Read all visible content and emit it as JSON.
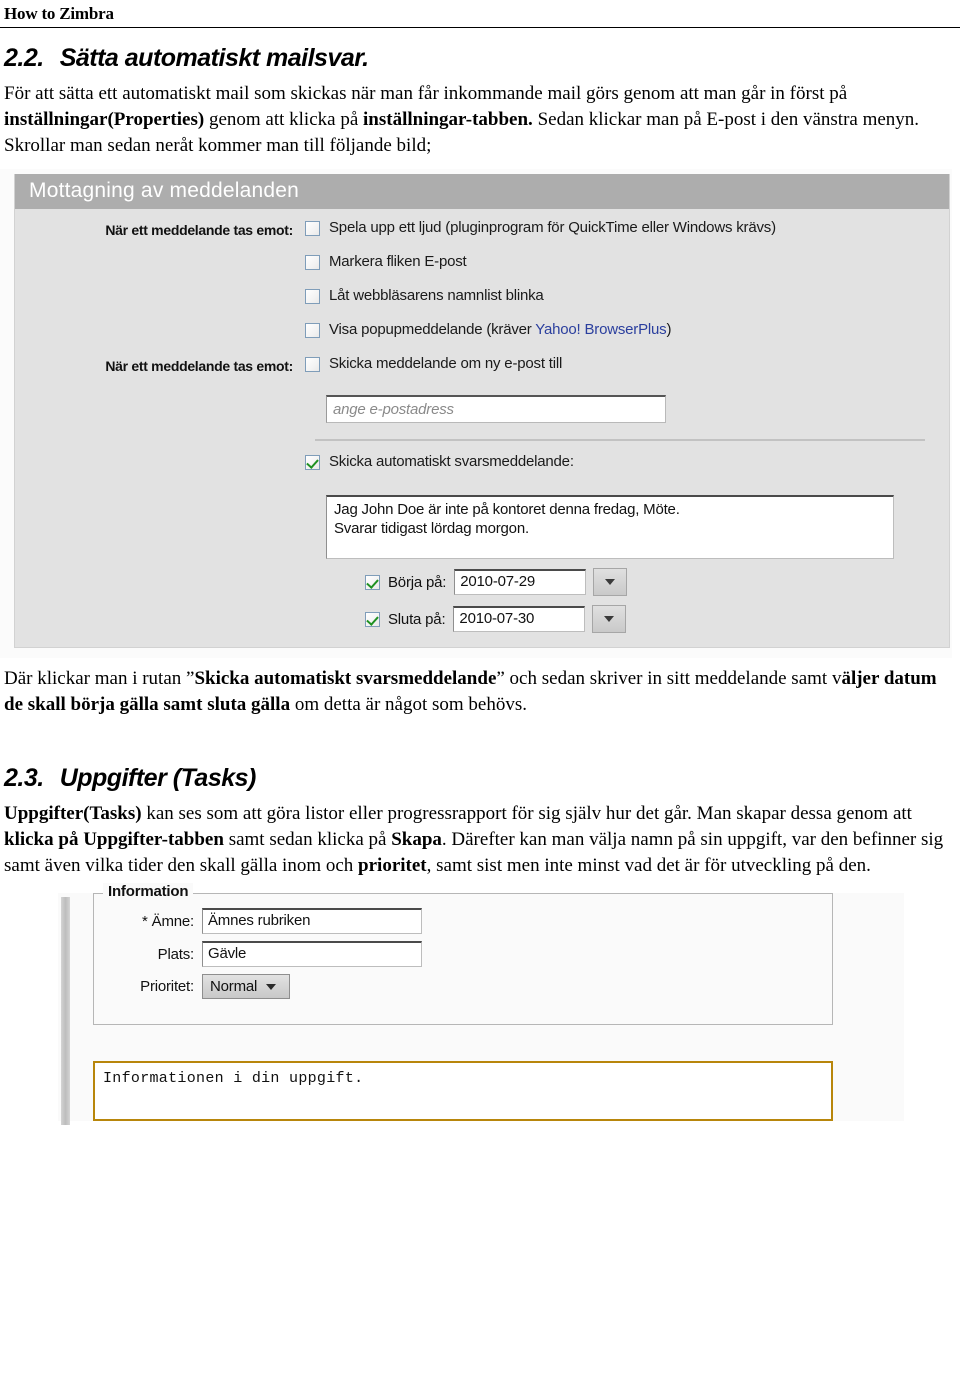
{
  "document": {
    "running_header": "How to Zimbra",
    "section_2_2": {
      "number": "2.2.",
      "title": "Sätta automatiskt mailsvar.",
      "paragraph_html": "För att sätta ett automatiskt mail som skickas när man får inkommande mail görs genom att man går in först på <b>inställningar(Properties)</b> genom att klicka på <b>inställningar-tabben.</b> Sedan klickar man på E-post i den vänstra menyn. Skrollar man sedan neråt kommer man till följande bild;"
    },
    "caption_after_shot1_html": "Där klickar man i rutan ”<b>Skicka automatiskt svarsmeddelande</b>” och sedan skriver in sitt meddelande samt v<b>äljer datum de skall börja gälla samt sluta gälla</b> om detta är något som behövs.",
    "section_2_3": {
      "number": "2.3.",
      "title": "Uppgifter (Tasks)",
      "paragraph_html": "<b>Uppgifter(Tasks)</b> kan ses som att göra listor eller progressrapport för sig själv hur det går. Man skapar dessa genom att <b>klicka på Uppgifter-tabben</b> samt sedan klicka på <b>Skapa</b>. Därefter kan man välja namn på sin uppgift, var den befinner sig samt även vilka tider den skall gälla inom och <b>prioritet</b>, samt sist men inte minst vad det är för utveckling på den."
    }
  },
  "screenshot_mail_prefs": {
    "panel_title": "Mottagning av meddelanden",
    "label_on_message_received_1": "När ett meddelande tas emot:",
    "label_on_message_received_2": "När ett meddelande tas emot:",
    "checkboxes": [
      {
        "label": "Spela upp ett ljud (pluginprogram för QuickTime eller Windows krävs)",
        "checked": false
      },
      {
        "label": "Markera fliken E-post",
        "checked": false
      },
      {
        "label": "Låt webbläsarens namnlist blinka",
        "checked": false
      },
      {
        "label_pre": "Visa popupmeddelande (kräver ",
        "label_link": "Yahoo! BrowserPlus",
        "label_post": ")",
        "checked": false
      },
      {
        "label": "Skicka meddelande om ny e-post till",
        "checked": false
      }
    ],
    "email_field": {
      "placeholder": "ange e-postadress",
      "value": ""
    },
    "auto_reply": {
      "checkbox_label": "Skicka automatiskt svarsmeddelande:",
      "checked": true,
      "message": "Jag John Doe är inte på kontoret denna fredag, Möte.\nSvarar tidigast lördag morgon."
    },
    "start_date": {
      "label": "Börja på:",
      "value": "2010-07-29",
      "checked": true
    },
    "end_date": {
      "label": "Sluta på:",
      "value": "2010-07-30",
      "checked": true
    },
    "dropdown_icon": "chevron-down-icon",
    "colors": {
      "panel_header_bg": "#adadad",
      "panel_bg": "#e2e2e2",
      "check_green": "#1f9122",
      "link_blue": "#2b3f9e"
    }
  },
  "screenshot_task_info": {
    "fieldset_legend": "Information",
    "fields": [
      {
        "label": "* Ämne:",
        "value": "Ämnes rubriken",
        "type": "text"
      },
      {
        "label": "Plats:",
        "value": "Gävle",
        "type": "text"
      },
      {
        "label": "Prioritet:",
        "value": "Normal",
        "type": "select"
      }
    ],
    "editor_text": "Informationen i din uppgift.",
    "colors": {
      "editor_border": "#b8860b",
      "panel_bg": "#fafafa"
    }
  }
}
